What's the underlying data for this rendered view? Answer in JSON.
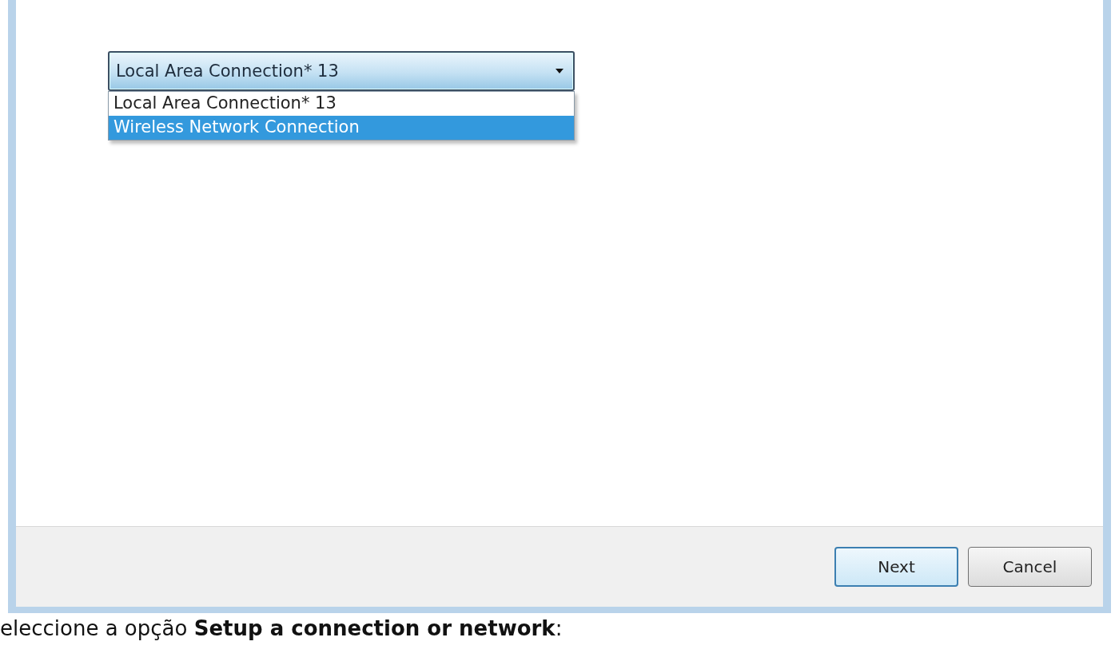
{
  "dialog": {
    "dropdown": {
      "value": "Local Area Connection* 13",
      "expanded": true,
      "options": [
        {
          "label": "Local Area Connection* 13",
          "highlighted": false
        },
        {
          "label": "Wireless Network Connection",
          "highlighted": true
        }
      ]
    },
    "buttons": [
      {
        "label": "Next",
        "default": true
      },
      {
        "label": "Cancel",
        "default": false
      }
    ]
  },
  "caption": "eleccione a opção **Setup a connection or network**:"
}
